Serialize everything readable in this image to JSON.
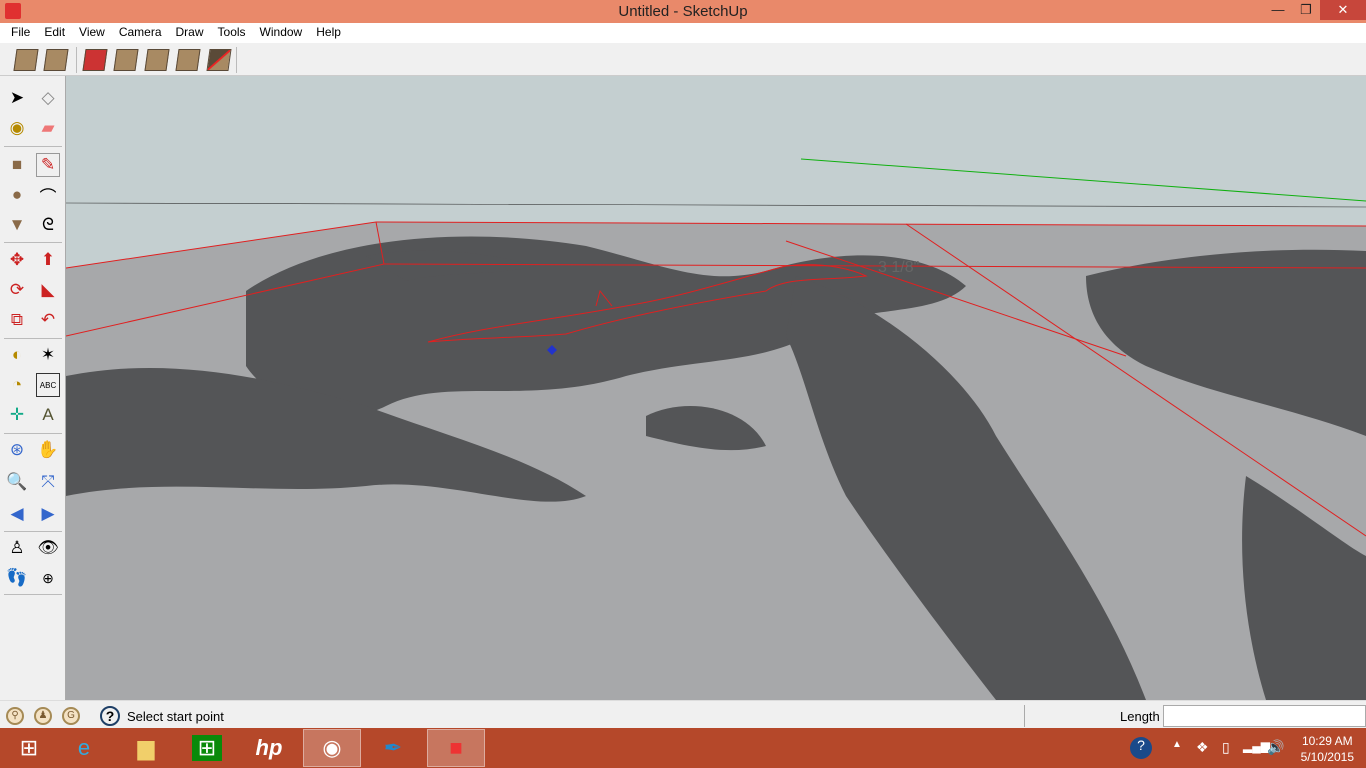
{
  "window": {
    "title": "Untitled - SketchUp",
    "minimize": "—",
    "restore": "❐",
    "close": "✕"
  },
  "menu": [
    "File",
    "Edit",
    "View",
    "Camera",
    "Draw",
    "Tools",
    "Window",
    "Help"
  ],
  "toolbar": [
    "sandbox-from-contours",
    "sandbox-from-scratch",
    "smoove",
    "stamp",
    "drape",
    "add-detail",
    "flip-edge"
  ],
  "palette": [
    "select",
    "make-component",
    "paint-bucket",
    "eraser",
    "rectangle",
    "line",
    "circle",
    "arc",
    "polygon",
    "freehand",
    "move",
    "push-pull",
    "rotate",
    "follow-me",
    "scale",
    "offset",
    "tape-measure",
    "dimension",
    "protractor",
    "text",
    "axes",
    "3d-text",
    "orbit",
    "pan",
    "zoom",
    "zoom-extents",
    "previous",
    "next",
    "position-camera",
    "look-around",
    "walk",
    "section-plane"
  ],
  "viewport": {
    "dimension_label": "3 1/8\"",
    "colors": {
      "sky": "#c4cfd0",
      "ground": "#a7a8aa",
      "shape": "#545557",
      "edge": "#e02020",
      "green_axis": "#10b010"
    }
  },
  "status": {
    "text": "Select start point",
    "length_label": "Length",
    "length_value": ""
  },
  "taskbar": {
    "apps": [
      "start",
      "internet-explorer",
      "file-explorer",
      "store",
      "hp",
      "chrome",
      "photo-app",
      "sketchup"
    ],
    "time": "10:29 AM",
    "date": "5/10/2015"
  }
}
